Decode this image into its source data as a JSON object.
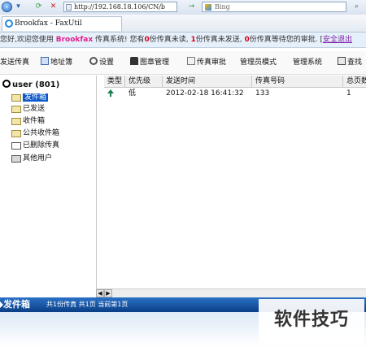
{
  "browser": {
    "url": "http://192.168.18.106/CN/b",
    "search_placeholder": "Bing",
    "tab_title": "Brookfax - FaxUtil"
  },
  "notice": {
    "p1": "您好,欢迎您使用 ",
    "brand": "Brookfax",
    "p2": " 传真系统! 您有",
    "n_unread": "0",
    "p3": "份传真未读, ",
    "n_sent": "1",
    "p4": "份传真未发送, ",
    "n_wait": "0",
    "p5": "份传真等待您的审批. [",
    "link": "安全退出"
  },
  "toolbar": {
    "send_fax": "发送传真",
    "address_book": "地址簿",
    "settings": "设置",
    "seal_manage": "图章管理",
    "fax_approve": "传真审批",
    "admin_mode": "管理员模式",
    "manage_system": "管理系统",
    "search": "查找"
  },
  "tree": {
    "root": "user (801)",
    "items": [
      "发件箱",
      "已发送",
      "收件箱",
      "公共收件箱",
      "已删除传真",
      "其他用户"
    ]
  },
  "table": {
    "columns": [
      "类型",
      "优先级",
      "发送时间",
      "传真号码",
      "总页数"
    ],
    "rows": [
      {
        "type_icon": "up-arrow-icon",
        "priority": "低",
        "time": "2012-02-18 16:41:32",
        "fax": "133",
        "pages": "1"
      }
    ]
  },
  "outbox": {
    "title": "发件箱",
    "stats": "共1份传真  共1页  当前第1页"
  },
  "watermark": "软件技巧",
  "colors": {
    "accent": "#0a58c9",
    "outbar": "#0a3e86",
    "pink": "#e0208c",
    "red": "#d9001b"
  }
}
